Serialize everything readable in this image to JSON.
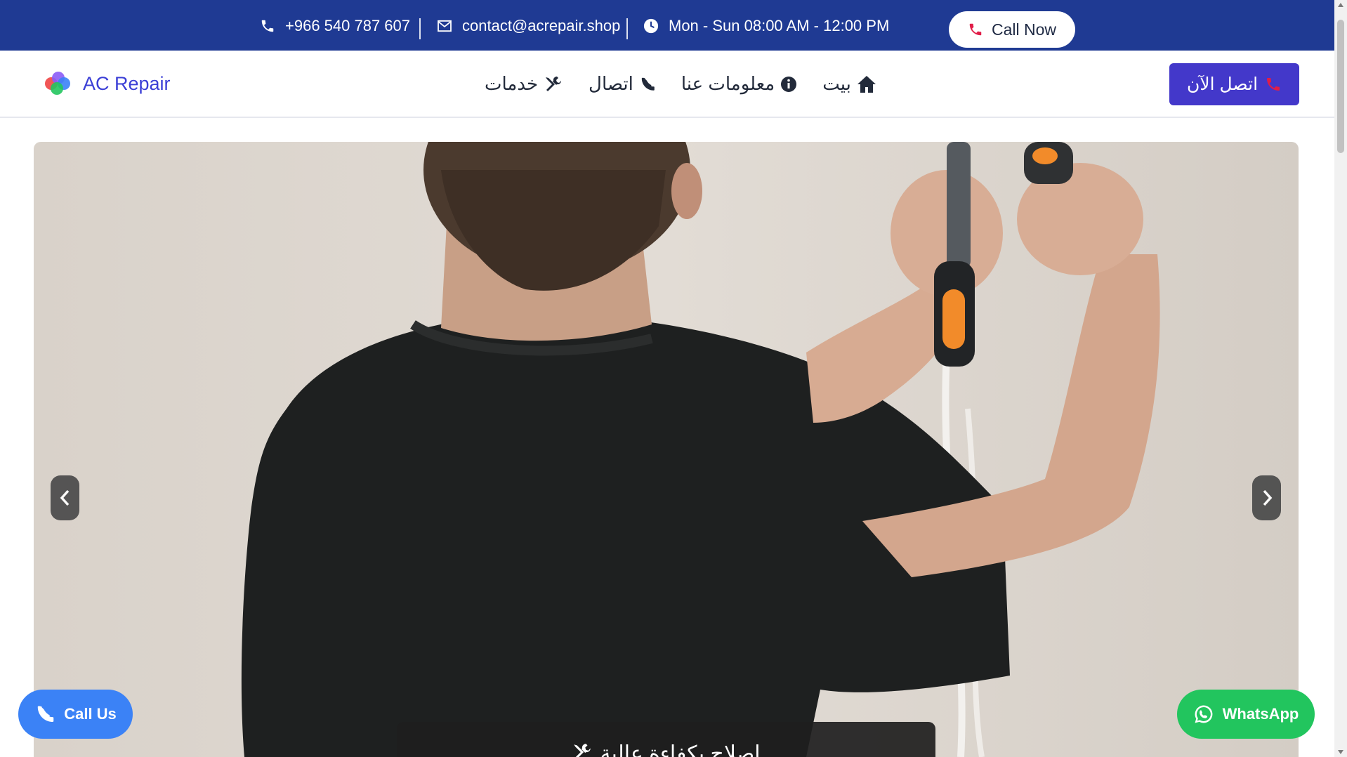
{
  "topbar": {
    "phone": "+966 540 787 607",
    "email": "contact@acrepair.shop",
    "hours": "Mon - Sun 08:00 AM - 12:00 PM",
    "call_now_label": "Call Now"
  },
  "navbar": {
    "brand": "AC Repair",
    "menu": [
      {
        "label": "بيت",
        "icon": "home-icon"
      },
      {
        "label": "معلومات عنا",
        "icon": "info-icon"
      },
      {
        "label": "اتصال",
        "icon": "phone-icon"
      },
      {
        "label": "خدمات",
        "icon": "tools-icon"
      }
    ],
    "cta_label": "اتصل الآن"
  },
  "hero": {
    "caption": "إصلاح بكفاءة عالية"
  },
  "floating": {
    "call_us_label": "Call Us",
    "whatsapp_label": "WhatsApp"
  },
  "colors": {
    "topbar": "#1f3a93",
    "brand": "#3b3fd6",
    "cta": "#4338ca",
    "call_us": "#3b82f6",
    "whatsapp": "#22c55e",
    "phone_accent": "#e11d48"
  }
}
